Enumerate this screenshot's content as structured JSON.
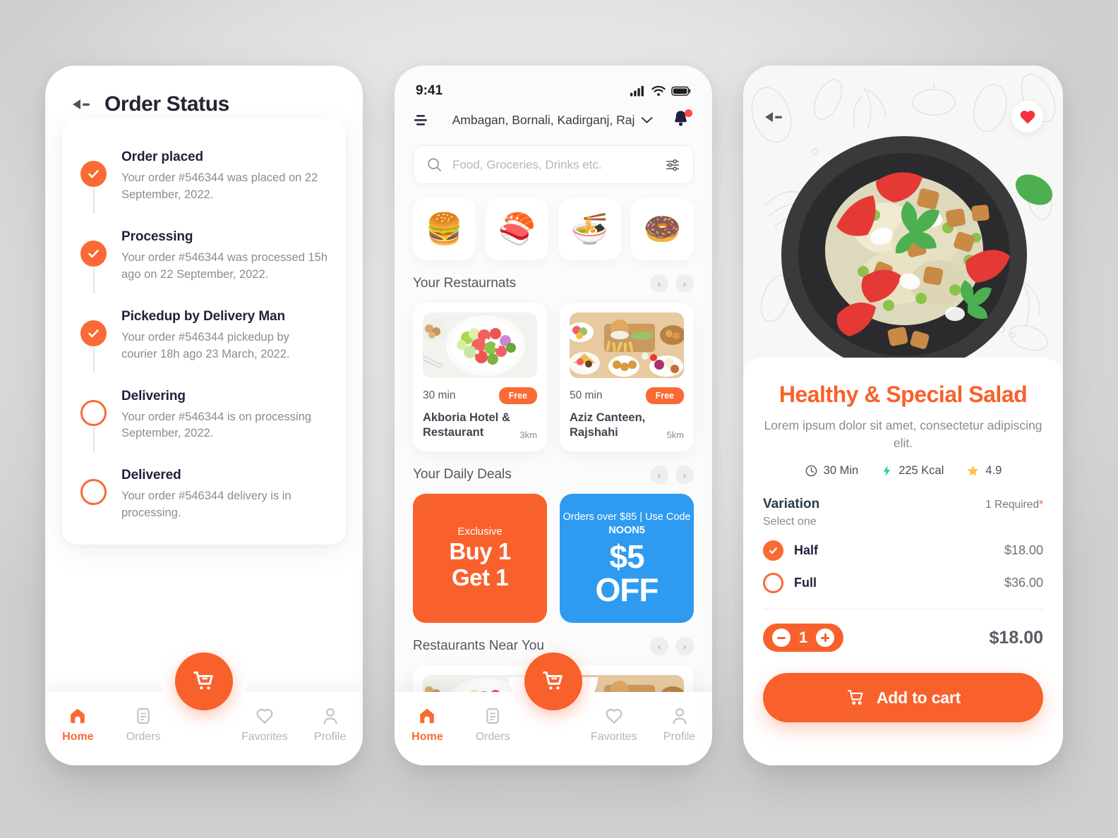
{
  "theme": {
    "accent": "#F9612C",
    "accent_alt": "#F96A34",
    "blue": "#2E9BF0",
    "dark": "#241F3B",
    "muted": "#8B8B95"
  },
  "screen1": {
    "back_icon": "back-arrow-icon",
    "title": "Order Status",
    "steps": [
      {
        "title": "Order placed",
        "desc": "Your order #546344 was placed on 22 September, 2022.",
        "state": "done"
      },
      {
        "title": "Processing",
        "desc": "Your order #546344 was processed  15h ago on 22 September, 2022.",
        "state": "done"
      },
      {
        "title": "Pickedup by Delivery Man",
        "desc": "Your order #546344 pickedup by courier 18h ago 23 March, 2022.",
        "state": "done"
      },
      {
        "title": "Delivering",
        "desc": "Your order #546344 is on processing September, 2022.",
        "state": "todo"
      },
      {
        "title": "Delivered",
        "desc": "Your order #546344 delivery is in processing.",
        "state": "todo"
      }
    ]
  },
  "screen2": {
    "statusbar": {
      "time": "9:41",
      "signal_icon": "cellular-signal-icon",
      "wifi_icon": "wifi-icon",
      "battery_icon": "battery-icon"
    },
    "menu_icon": "hamburger-menu-icon",
    "location": "Ambagan, Bornali, Kadirganj, Raj",
    "location_chevron": "chevron-down-icon",
    "bell_icon": "notification-bell-icon",
    "search": {
      "icon": "search-icon",
      "placeholder": "Food, Groceries, Drinks etc.",
      "filter_icon": "filter-sliders-icon"
    },
    "categories": [
      {
        "name": "burger",
        "glyph": "🍔"
      },
      {
        "name": "sushi",
        "glyph": "🍣"
      },
      {
        "name": "noodles",
        "glyph": "🍜"
      },
      {
        "name": "donut",
        "glyph": "🍩"
      }
    ],
    "sections": [
      {
        "title": "Your Restaurnats",
        "prev": "‹",
        "next": "›"
      },
      {
        "title": "Your Daily Deals",
        "prev": "‹",
        "next": "›"
      },
      {
        "title": "Restaurants Near You",
        "prev": "‹",
        "next": "›"
      }
    ],
    "restaurants": [
      {
        "time": "30 min",
        "badge": "Free",
        "name": "Akboria Hotel & Restaurant",
        "distance": "3km",
        "image": "watermelon-salad-photo"
      },
      {
        "time": "50 min",
        "badge": "Free",
        "name": "Aziz Canteen, Rajshahi",
        "distance": "5km",
        "image": "mixed-platter-photo"
      }
    ],
    "deals": [
      {
        "kicker": "Exclusive",
        "line1": "Buy 1",
        "line2": "Get 1",
        "color": "#F9612C"
      },
      {
        "top_plain": "Orders over $85 | Use Code ",
        "top_bold": "NOON5",
        "line1": "$5",
        "line2": "OFF",
        "color": "#2E9BF0"
      }
    ],
    "near": [
      {
        "image": "watermelon-salad-photo"
      },
      {
        "image": "mixed-platter-photo"
      }
    ],
    "nav": {
      "fab_icon": "shopping-cart-icon",
      "items": [
        {
          "label": "Home",
          "icon": "home-icon",
          "active": true
        },
        {
          "label": "Orders",
          "icon": "document-list-icon",
          "active": false
        },
        {
          "label": "Favorites",
          "icon": "heart-icon",
          "active": false
        },
        {
          "label": "Profile",
          "icon": "person-icon",
          "active": false
        }
      ]
    }
  },
  "screen3": {
    "back_icon": "back-arrow-icon",
    "favorite_icon": "heart-filled-icon",
    "hero_image": "salad-on-dark-plate-photo",
    "title": "Healthy & Special Salad",
    "description": "Lorem ipsum dolor sit amet, consectetur adipiscing elit.",
    "stats": [
      {
        "icon": "clock-icon",
        "value": "30 Min"
      },
      {
        "icon": "lightning-bolt-icon",
        "value": "225 Kcal"
      },
      {
        "icon": "star-icon",
        "value": "4.9"
      }
    ],
    "variation": {
      "title": "Variation",
      "required_text": "1 Required",
      "required_mark": "*",
      "subtitle": "Select one",
      "options": [
        {
          "label": "Half",
          "price": "$18.00",
          "selected": true
        },
        {
          "label": "Full",
          "price": "$36.00",
          "selected": false
        }
      ]
    },
    "quantity": {
      "value": "1",
      "minus_icon": "minus-icon",
      "plus_icon": "plus-icon"
    },
    "total": "$18.00",
    "cart_button": {
      "label": "Add to cart",
      "icon": "shopping-cart-icon"
    }
  }
}
